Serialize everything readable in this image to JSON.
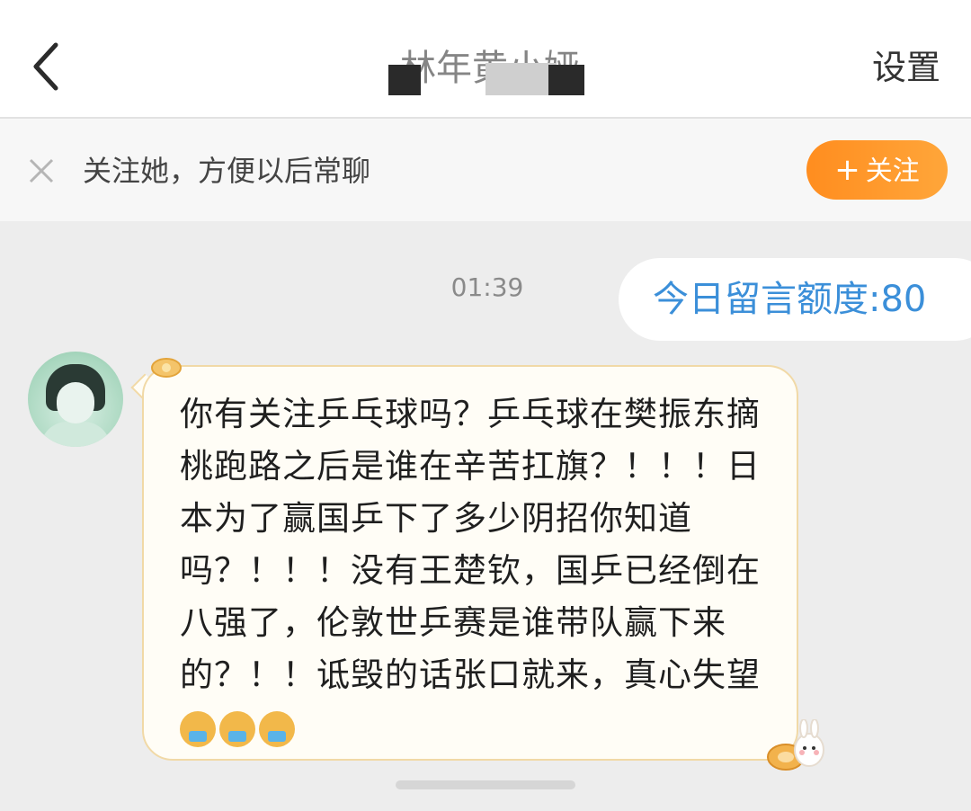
{
  "header": {
    "back_label": "<",
    "title": "林年黄小娅",
    "settings_label": "设置"
  },
  "banner": {
    "text": "关注她，方便以后常聊",
    "follow_button": "关注"
  },
  "chat": {
    "time": "01:39",
    "quota_text": "今日留言额度:80",
    "message": "你有关注乒乓球吗？乒乓球在樊振东摘桃跑路之后是谁在辛苦扛旗？！！！日本为了赢国乒下了多少阴招你知道吗？！！！没有王楚钦，国乒已经倒在八强了，伦敦世乒赛是谁带队赢下来的？！！诋毁的话张口就来，真心失望",
    "emojis": [
      "puking-face",
      "puking-face",
      "puking-face"
    ]
  },
  "colors": {
    "accent": "#ff931f",
    "quota_text": "#3b8fd9",
    "bubble_border": "#f1d9a6"
  }
}
